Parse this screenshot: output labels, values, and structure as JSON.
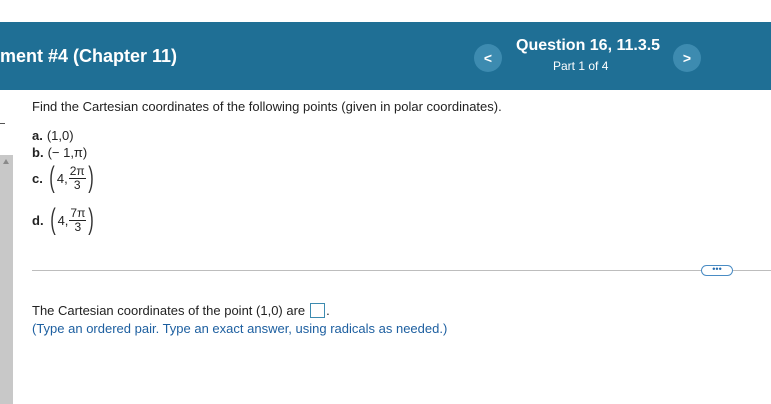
{
  "header": {
    "title": "ment #4 (Chapter 11)",
    "question_title": "Question 16, 11.3.5",
    "part": "Part 1 of 4",
    "prev_icon": "<",
    "next_icon": ">"
  },
  "problem": {
    "prompt": "Find the Cartesian coordinates of the following points (given in polar coordinates).",
    "items": [
      {
        "label": "a.",
        "point": "(1,0)"
      },
      {
        "label": "b.",
        "point": "(− 1,π)"
      },
      {
        "label": "c.",
        "first": "4,",
        "num": "2π",
        "den": "3"
      },
      {
        "label": "d.",
        "first": "4,",
        "num": "7π",
        "den": "3"
      }
    ],
    "paren_left": "(",
    "paren_right": ")"
  },
  "more_button": "•••",
  "answer": {
    "text": "The Cartesian coordinates of the point (1,0) are",
    "period": ".",
    "hint": "(Type an ordered pair. Type an exact answer, using radicals as needed.)"
  }
}
